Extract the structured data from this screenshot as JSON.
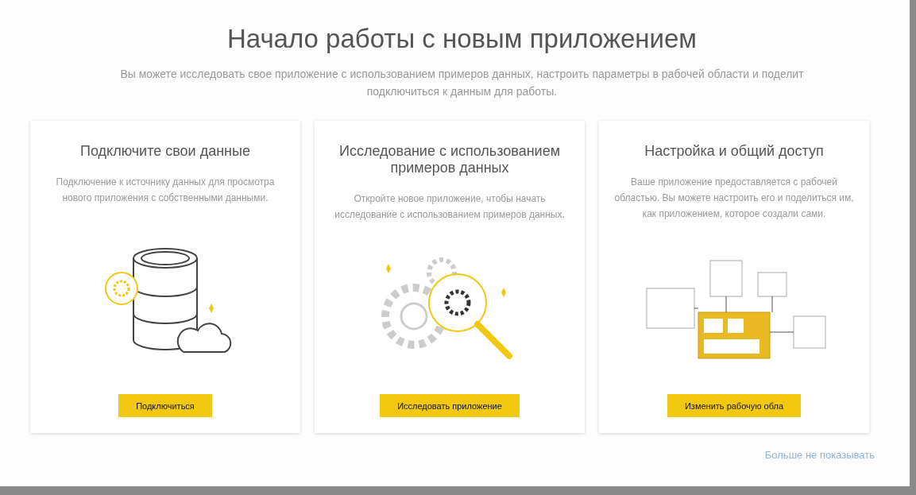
{
  "dialog": {
    "title": "Начало работы с новым приложением",
    "subtitle_lines": [
      "Вы можете исследовать свое приложение с использованием примеров данных, настроить параметры в рабочей области и поделит",
      "подключиться к данным для работы."
    ]
  },
  "cards": [
    {
      "kind": "database",
      "title": "Подключите свои данные",
      "description": "Подключение к источнику данных для просмотра нового приложения с собственными данными.",
      "button": "Подключиться"
    },
    {
      "kind": "explore",
      "title": "Исследование с использованием примеров данных",
      "description": "Откройте новое приложение, чтобы начать исследование с использованием примеров данных.",
      "button": "Исследовать приложение"
    },
    {
      "kind": "workspace",
      "title": "Настройка и общий доступ",
      "description": "Ваше приложение предоставляется с рабочей областью. Вы можете настроить его и поделиться им, как приложением, которое создали сами.",
      "button": "Изменить рабочую обла"
    }
  ],
  "footer_link": "Больше не показывать"
}
